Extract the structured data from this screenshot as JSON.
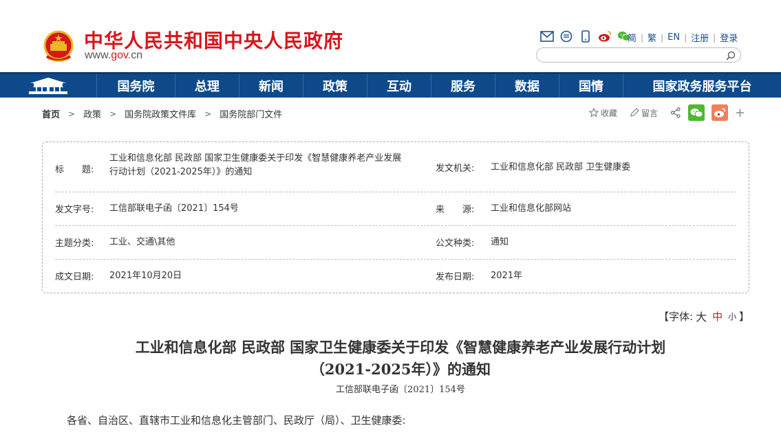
{
  "header": {
    "site_title": "中华人民共和国中央人民政府",
    "url_prefix": "www.",
    "url_gov": "gov",
    "url_suffix": ".cn",
    "icons": [
      "mail-icon",
      "chat-icon",
      "mobile-icon",
      "weibo-icon",
      "wechat-icon"
    ],
    "links": [
      "简",
      "繁",
      "EN",
      "注册",
      "登录"
    ],
    "search_placeholder": ""
  },
  "nav": {
    "items": [
      "国务院",
      "总理",
      "新闻",
      "政策",
      "互动",
      "服务",
      "数据",
      "国情",
      "国家政务服务平台"
    ]
  },
  "breadcrumb": {
    "items": [
      "首页",
      "政策",
      "国务院政策文件库",
      "国务院部门文件"
    ]
  },
  "share": {
    "favorite": "收藏",
    "comment": "留言"
  },
  "info": {
    "title_label": "标　　题:",
    "title_value_line1": "工业和信息化部 民政部 国家卫生健康委关于印发《智慧健康养老产业发展",
    "title_value_line2": "行动计划（2021-2025年）》的通知",
    "issuer_label": "发文机关:",
    "issuer_value": "工业和信息化部 民政部 卫生健康委",
    "docno_label": "发文字号:",
    "docno_value": "工信部联电子函〔2021〕154号",
    "source_label": "来　　源:",
    "source_value": "工业和信息化部网站",
    "topic_label": "主题分类:",
    "topic_value": "工业、交通\\其他",
    "type_label": "公文种类:",
    "type_value": "通知",
    "date_label": "成文日期:",
    "date_value": "2021年10月20日",
    "pub_label": "发布日期:",
    "pub_value": "2021年"
  },
  "fontsize": {
    "open": "【字体:",
    "big": "大",
    "mid": "中",
    "small": "小",
    "close": "】"
  },
  "article": {
    "title_line1": "工业和信息化部 民政部 国家卫生健康委关于印发《智慧健康养老产业发展行动计划",
    "title_line2": "（2021-2025年）》的通知",
    "doc_no": "工信部联电子函〔2021〕154号",
    "greeting": "各省、自治区、直辖市工业和信息化主管部门、民政厅（局）、卫生健康委:"
  },
  "colors": {
    "brand_red": "#d6171c",
    "nav_blue": "#0e4a8a",
    "link_blue": "#1a4f8e",
    "wechat_green": "#4fb830",
    "weibo_orange": "#f0805a"
  }
}
